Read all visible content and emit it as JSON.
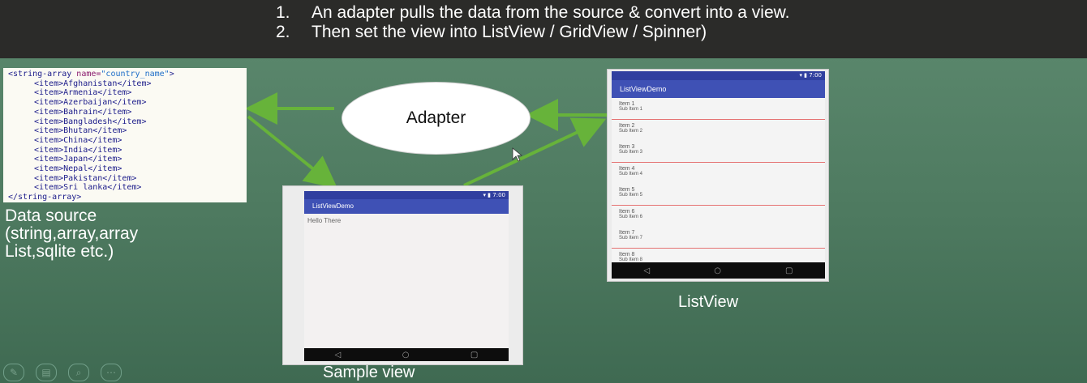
{
  "header": {
    "steps": [
      {
        "num": "1.",
        "text": "An adapter pulls the data from the source & convert into a view."
      },
      {
        "num": "2.",
        "text": "Then set the view into ListView / GridView / Spinner)"
      }
    ]
  },
  "code": {
    "open_tag": "<string-array",
    "attr_name": " name=",
    "attr_value": "\"country_name\"",
    "open_end": ">",
    "items": [
      "<item>Afghanistan</item>",
      "<item>Armenia</item>",
      "<item>Azerbaijan</item>",
      "<item>Bahrain</item>",
      "<item>Bangladesh</item>",
      "<item>Bhutan</item>",
      "<item>China</item>",
      "<item>India</item>",
      "<item>Japan</item>",
      "<item>Nepal</item>",
      "<item>Pakistan</item>",
      "<item>Sri lanka</item>"
    ],
    "close_tag": "</string-array>"
  },
  "data_source_label": [
    "Data source",
    "(string,array,array",
    "List,sqlite etc.)"
  ],
  "adapter_label": "Adapter",
  "sample_view": {
    "status_time": "7:00",
    "app_title": "ListViewDemo",
    "body_text": "Hello There",
    "caption": "Sample view"
  },
  "listview": {
    "status_time": "7:00",
    "app_title": "ListViewDemo",
    "items": [
      {
        "title": "Item 1",
        "sub": "Sub Item 1"
      },
      {
        "title": "Item 2",
        "sub": "Sub Item 2"
      },
      {
        "title": "Item 3",
        "sub": "Sub Item 3"
      },
      {
        "title": "Item 4",
        "sub": "Sub Item 4"
      },
      {
        "title": "Item 5",
        "sub": "Sub Item 5"
      },
      {
        "title": "Item 6",
        "sub": "Sub Item 6"
      },
      {
        "title": "Item 7",
        "sub": "Sub Item 7"
      },
      {
        "title": "Item 8",
        "sub": "Sub Item 8"
      }
    ],
    "caption": "ListView"
  },
  "nav_icons": {
    "back": "◁",
    "home": "○",
    "recent": "▢"
  },
  "colors": {
    "arrow": "#67b33a",
    "appbar": "#3f51b5",
    "background": "#4e7a60"
  }
}
